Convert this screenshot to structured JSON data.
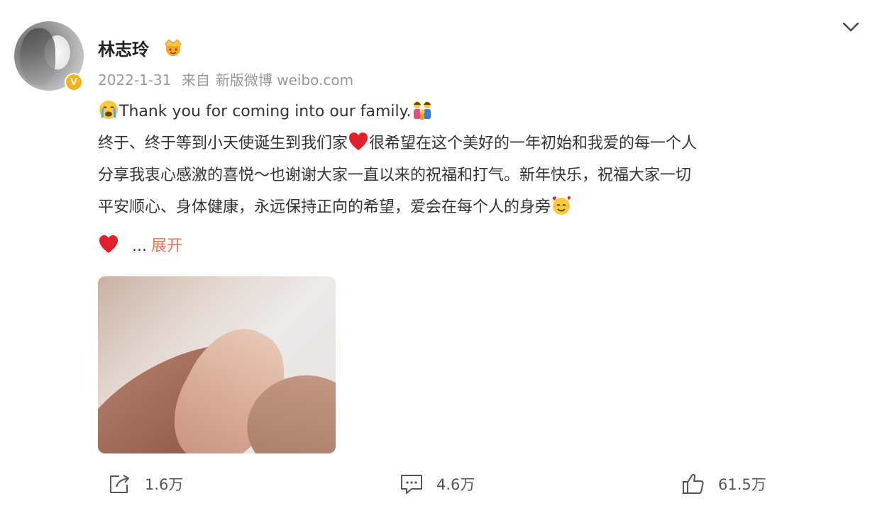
{
  "user": {
    "name": "林志玲",
    "verified_badge": "V"
  },
  "meta": {
    "date": "2022-1-31",
    "source_prefix": "来自",
    "source": "新版微博 weibo.com"
  },
  "post": {
    "line1": "Thank you for coming into our family.",
    "line2_a": "终于、终于等到小天使诞生到我们家",
    "line2_b": "很希望在这个美好的一年初始和我爱的每一个人",
    "line3": "分享我衷心感激的喜悦～也谢谢大家一直以来的祝福和打气。新年快乐，祝福大家一切",
    "line4": "平安顺心、身体健康，永远保持正向的希望，爱会在每个人的身旁",
    "ellipsis": "...",
    "expand_label": "展开"
  },
  "actions": {
    "repost_count": "1.6万",
    "comment_count": "4.6万",
    "like_count": "61.5万"
  },
  "icons": {
    "crown": "crown-emoji-icon",
    "crying": "crying-face-icon",
    "family": "family-icon",
    "heart": "red-heart-icon",
    "smile_hearts": "smiling-face-hearts-icon",
    "chevron": "chevron-down-icon",
    "repost": "repost-icon",
    "comment": "comment-icon",
    "like": "thumbs-up-icon"
  },
  "colors": {
    "expand": "#eb7350",
    "meta": "#999999",
    "verified": "#f7b21a",
    "heart": "#e0212b"
  }
}
